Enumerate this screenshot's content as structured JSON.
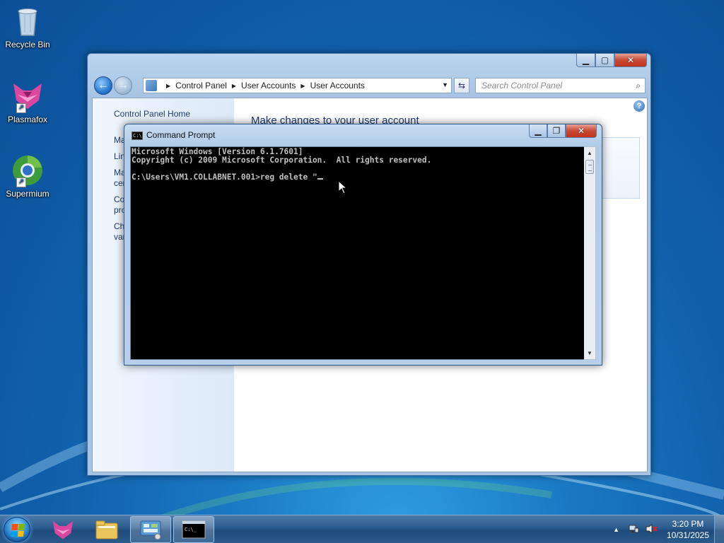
{
  "desktop": {
    "icons": [
      {
        "label": "Recycle Bin",
        "icon": "recycle-bin-icon"
      },
      {
        "label": "Plasmafox",
        "icon": "plasmafox-icon"
      },
      {
        "label": "Supermium",
        "icon": "supermium-icon"
      }
    ]
  },
  "control_panel": {
    "breadcrumb": [
      "Control Panel",
      "User Accounts",
      "User Accounts"
    ],
    "search_placeholder": "Search Control Panel",
    "left_nav_home": "Control Panel Home",
    "left_nav_stubs": [
      "Ma",
      "Lin",
      "Ma\ncer",
      "Co\npro",
      "Ch\nvar"
    ],
    "heading": "Make changes to your user account"
  },
  "cmd": {
    "title": "Command Prompt",
    "line1": "Microsoft Windows [Version 6.1.7601]",
    "line2": "Copyright (c) 2009 Microsoft Corporation.  All rights reserved.",
    "line3": "",
    "prompt": "C:\\Users\\VM1.COLLABNET.001>reg delete \""
  },
  "taskbar": {
    "time": "3:20 PM",
    "date": "10/31/2025",
    "items": [
      {
        "icon": "plasmafox-icon",
        "active": false
      },
      {
        "icon": "folder-icon",
        "active": false
      },
      {
        "icon": "control-panel-icon",
        "active": true
      },
      {
        "icon": "command-prompt-icon",
        "active": true
      }
    ]
  },
  "colors": {
    "accent": "#1160ab",
    "console_bg": "#000000",
    "console_fg": "#c0c0c0",
    "close_button": "#c74a35"
  }
}
